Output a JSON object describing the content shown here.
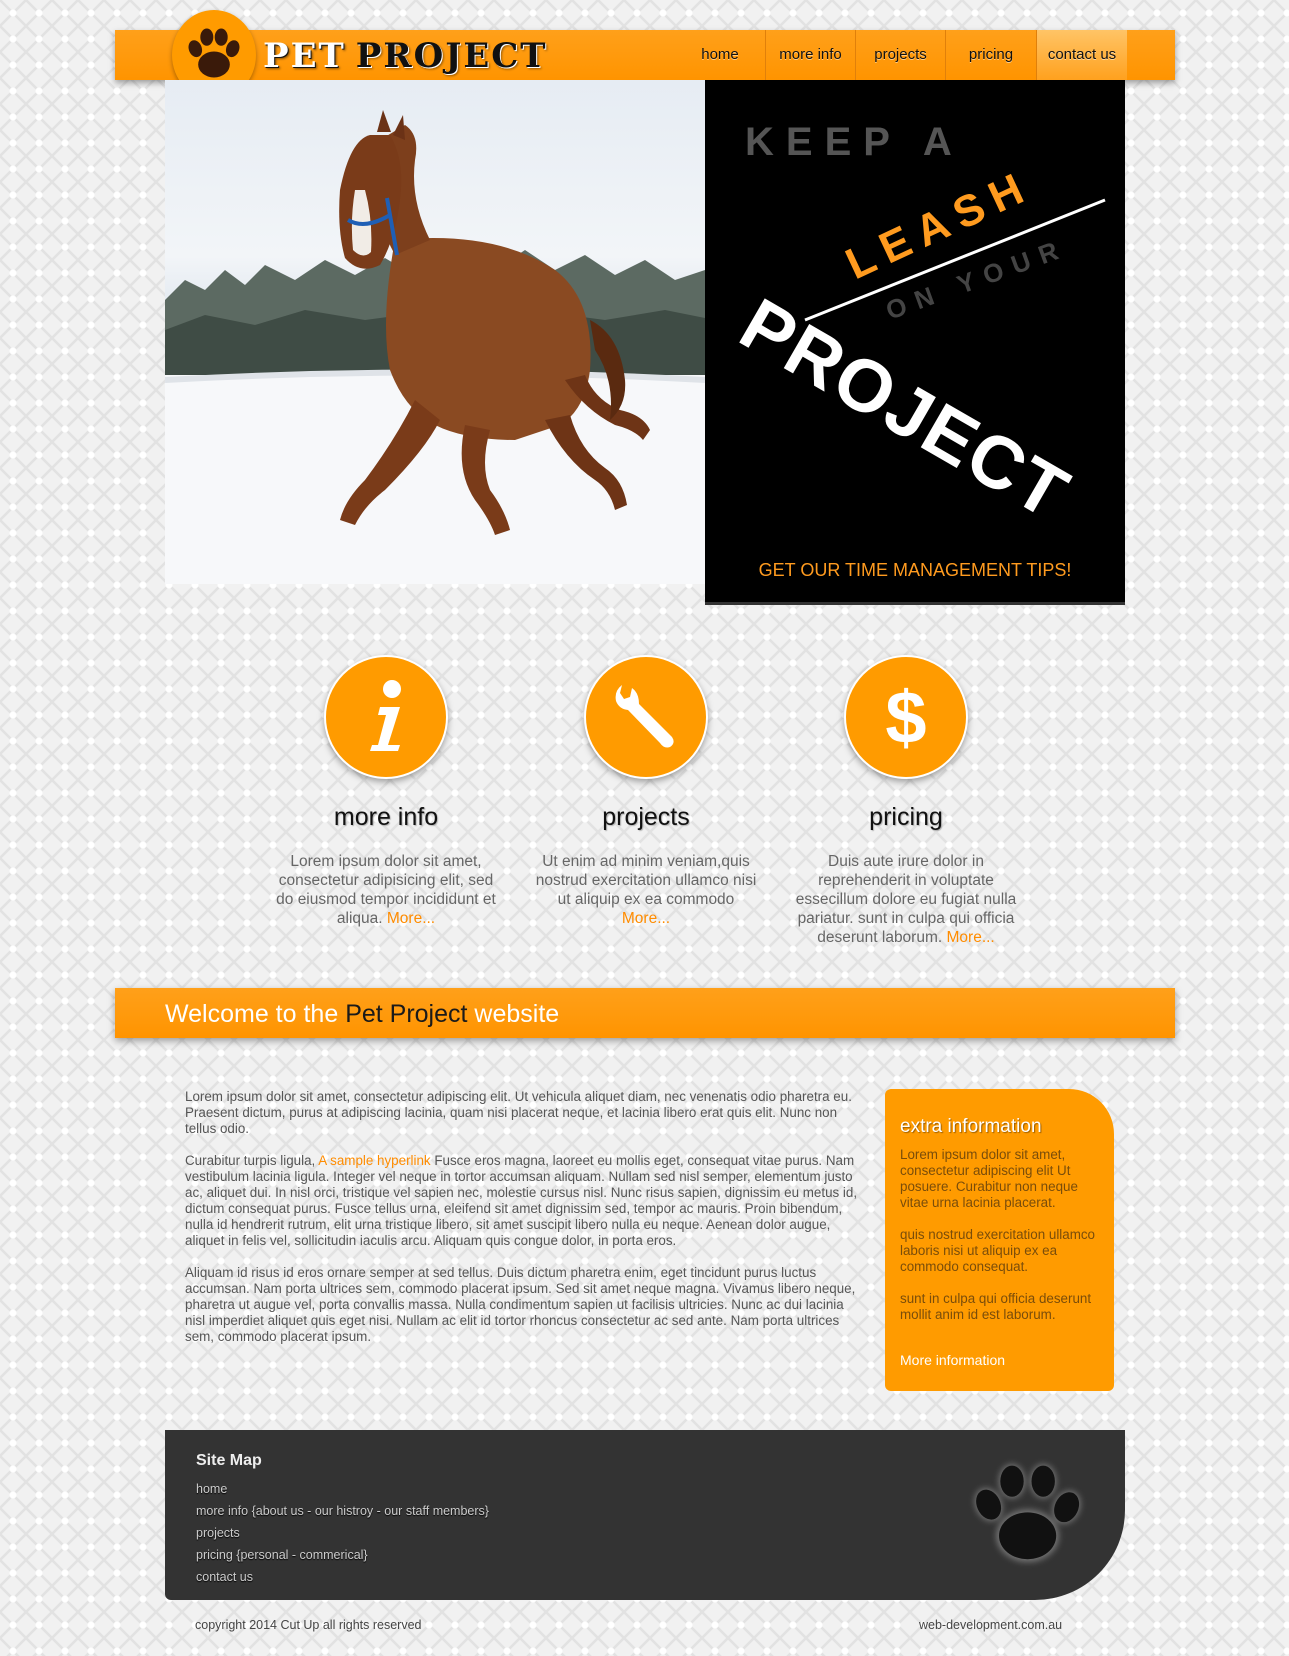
{
  "header": {
    "brand_first": "PET",
    "brand_second": "PROJECT",
    "nav": [
      {
        "label": "home"
      },
      {
        "label": "more info"
      },
      {
        "label": "projects"
      },
      {
        "label": "pricing"
      },
      {
        "label": "contact us"
      }
    ],
    "logo_icon": "paw-print-icon"
  },
  "hero": {
    "banner_line1": "KEEP A",
    "banner_line2": "LEASH",
    "banner_line3": "ON YOUR",
    "banner_line4": "PROJECT",
    "banner_tip": "GET OUR TIME MANAGEMENT TIPS!"
  },
  "features": [
    {
      "icon": "info-icon",
      "title": "more info",
      "text": "Lorem ipsum dolor sit amet, consectetur adipisicing elit, sed do eiusmod tempor incididunt et aliqua.",
      "more": "More..."
    },
    {
      "icon": "wrench-icon",
      "title": "projects",
      "text": "Ut enim ad minim veniam,quis nostrud exercitation ullamco nisi ut aliquip ex ea commodo",
      "more": "More..."
    },
    {
      "icon": "dollar-icon",
      "title": "pricing",
      "text": "Duis aute irure dolor in reprehenderit in voluptate essecillum dolore eu fugiat nulla pariatur. sunt in culpa qui officia deserunt laborum.",
      "more": "More..."
    }
  ],
  "welcome": {
    "prefix": "Welcome to the ",
    "highlight": "Pet Project",
    "suffix": " website"
  },
  "content": {
    "p1": "Lorem ipsum dolor sit amet, consectetur adipiscing elit. Ut vehicula aliquet diam, nec venenatis odio pharetra eu. Praesent dictum, purus at adipiscing lacinia, quam nisi placerat neque, et lacinia libero erat quis elit. Nunc non tellus odio.",
    "p2_before": "Curabitur turpis ligula, ",
    "p2_link": "A sample hyperlink",
    "p2_after": " Fusce eros magna, laoreet eu mollis eget, consequat vitae purus. Nam vestibulum lacinia ligula. Integer vel neque in tortor accumsan aliquam. Nullam sed nisl semper, elementum justo ac, aliquet dui. In nisl orci, tristique vel sapien nec, molestie cursus nisl. Nunc risus sapien, dignissim eu metus id, dictum consequat purus. Fusce tellus urna, eleifend sit amet dignissim sed, tempor ac mauris. Proin bibendum, nulla id hendrerit rutrum, elit urna tristique libero, sit amet suscipit libero nulla eu neque. Aenean dolor augue, aliquet in felis vel, sollicitudin iaculis arcu. Aliquam quis congue dolor, in porta eros.",
    "p3": "Aliquam id risus id eros ornare semper at sed tellus. Duis dictum pharetra enim, eget tincidunt purus luctus accumsan. Nam porta ultrices sem, commodo placerat ipsum. Sed sit amet neque magna. Vivamus libero neque, pharetra ut augue vel, porta convallis massa. Nulla condimentum sapien ut facilisis ultricies. Nunc ac dui lacinia nisl imperdiet aliquet quis eget nisi. Nullam ac elit id tortor rhoncus consectetur ac sed ante. Nam porta ultrices sem, commodo placerat ipsum."
  },
  "sidebar": {
    "title": "extra information",
    "p1": "Lorem ipsum dolor sit amet, consectetur adipiscing elit Ut posuere. Curabitur non neque vitae urna lacinia placerat.",
    "p2": "quis nostrud exercitation ullamco laboris nisi ut aliquip ex ea commodo consequat.",
    "p3": "sunt in culpa qui officia deserunt mollit anim id est laborum.",
    "link": "More information"
  },
  "footer": {
    "title": "Site Map",
    "links": [
      {
        "label": "home"
      },
      {
        "label": "more info {about us - our histroy - our staff members}"
      },
      {
        "label": "projects"
      },
      {
        "label": "pricing {personal - commerical}"
      },
      {
        "label": "contact us"
      }
    ],
    "copyright": "copyright 2014 Cut Up all rights reserved",
    "site_credit": "web-development.com.au"
  },
  "colors": {
    "accent": "#ff9b00",
    "footer_bg": "#333333",
    "text": "#555555"
  }
}
